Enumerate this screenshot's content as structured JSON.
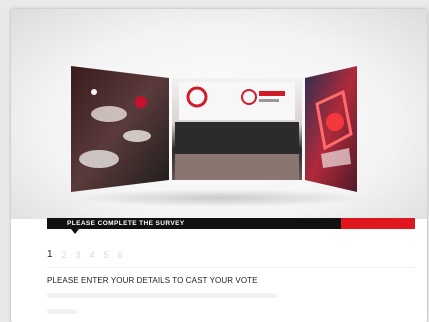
{
  "survey": {
    "progress_label": "PLEASE COMPLETE THE SURVEY",
    "progress_fraction": 0.2,
    "steps": [
      "1",
      "2",
      "3",
      "4",
      "5",
      "6"
    ],
    "active_step": 1,
    "heading": "PLEASE ENTER YOUR DETAILS TO CAST YOUR VOTE"
  },
  "colors": {
    "accent": "#e0161e",
    "bar": "#111111"
  },
  "icons": [
    "photo-banner"
  ]
}
